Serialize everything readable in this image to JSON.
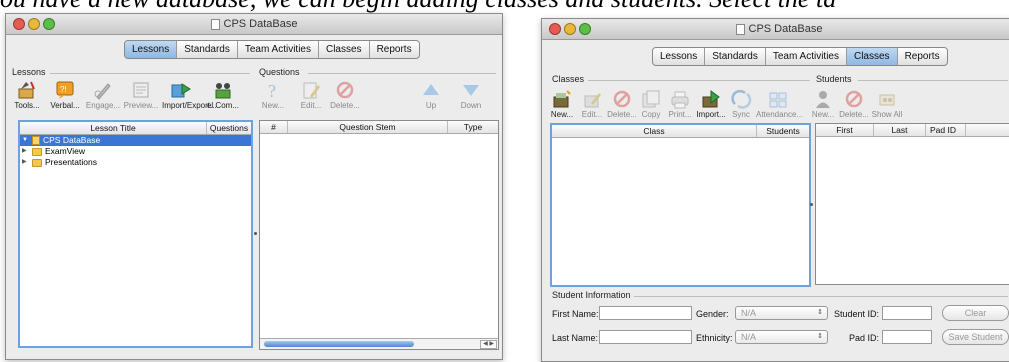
{
  "doc_text": "ou have a new database, we can begin adding classes and students. Select the ta",
  "window1": {
    "title": "CPS DataBase",
    "tabs": [
      {
        "label": "Lessons",
        "selected": true
      },
      {
        "label": "Standards",
        "selected": false
      },
      {
        "label": "Team Activities",
        "selected": false
      },
      {
        "label": "Classes",
        "selected": false
      },
      {
        "label": "Reports",
        "selected": false
      }
    ],
    "lessons_section": "Lessons",
    "questions_section": "Questions",
    "lesson_tools": [
      {
        "label": "Tools...",
        "icon": "tools-icon",
        "enabled": true
      },
      {
        "label": "Verbal...",
        "icon": "verbal-icon",
        "enabled": true
      },
      {
        "label": "Engage...",
        "icon": "engage-icon",
        "enabled": false
      },
      {
        "label": "Preview...",
        "icon": "preview-icon",
        "enabled": false
      },
      {
        "label": "Import/Export...",
        "icon": "import-export-icon",
        "enabled": true
      },
      {
        "label": "el Com...",
        "icon": "com-icon",
        "enabled": true
      }
    ],
    "question_tools": [
      {
        "label": "New...",
        "icon": "new-question-icon",
        "enabled": false
      },
      {
        "label": "Edit...",
        "icon": "edit-icon",
        "enabled": false
      },
      {
        "label": "Delete...",
        "icon": "delete-icon",
        "enabled": false
      },
      {
        "label": "Up",
        "icon": "up-arrow-icon",
        "enabled": false
      },
      {
        "label": "Down",
        "icon": "down-arrow-icon",
        "enabled": false
      }
    ],
    "lesson_table": {
      "columns": [
        "Lesson Title",
        "Questions"
      ],
      "rows": [
        {
          "label": "CPS DataBase",
          "selected": true,
          "expanded": true
        },
        {
          "label": "ExamView",
          "selected": false,
          "expanded": false
        },
        {
          "label": "Presentations",
          "selected": false,
          "expanded": false
        }
      ]
    },
    "question_table": {
      "columns": [
        "#",
        "Question Stem",
        "Type"
      ]
    }
  },
  "window2": {
    "title": "CPS DataBase",
    "tabs": [
      {
        "label": "Lessons",
        "selected": false
      },
      {
        "label": "Standards",
        "selected": false
      },
      {
        "label": "Team Activities",
        "selected": false
      },
      {
        "label": "Classes",
        "selected": true
      },
      {
        "label": "Reports",
        "selected": false
      }
    ],
    "classes_section": "Classes",
    "students_section": "Students",
    "class_tools": [
      {
        "label": "New...",
        "icon": "new-class-icon",
        "enabled": true
      },
      {
        "label": "Edit...",
        "icon": "edit-icon",
        "enabled": false
      },
      {
        "label": "Delete...",
        "icon": "delete-icon",
        "enabled": false
      },
      {
        "label": "Copy",
        "icon": "copy-icon",
        "enabled": false
      },
      {
        "label": "Print...",
        "icon": "print-icon",
        "enabled": false
      },
      {
        "label": "Import...",
        "icon": "import-icon",
        "enabled": true
      },
      {
        "label": "Sync",
        "icon": "sync-icon",
        "enabled": false
      },
      {
        "label": "Attendance...",
        "icon": "attendance-icon",
        "enabled": false
      }
    ],
    "student_tools": [
      {
        "label": "New...",
        "icon": "new-student-icon",
        "enabled": false
      },
      {
        "label": "Delete...",
        "icon": "delete-icon",
        "enabled": false
      },
      {
        "label": "Show All",
        "icon": "show-all-icon",
        "enabled": false
      }
    ],
    "class_table": {
      "columns": [
        "Class",
        "Students"
      ]
    },
    "student_table": {
      "columns": [
        "First",
        "Last",
        "Pad ID"
      ]
    },
    "student_info": {
      "section": "Student Information",
      "first_name_label": "First Name:",
      "last_name_label": "Last Name:",
      "gender_label": "Gender:",
      "gender_value": "N/A",
      "ethnicity_label": "Ethnicity:",
      "ethnicity_value": "N/A",
      "student_id_label": "Student ID:",
      "pad_id_label": "Pad ID:",
      "clear_label": "Clear",
      "save_label": "Save Student"
    }
  }
}
